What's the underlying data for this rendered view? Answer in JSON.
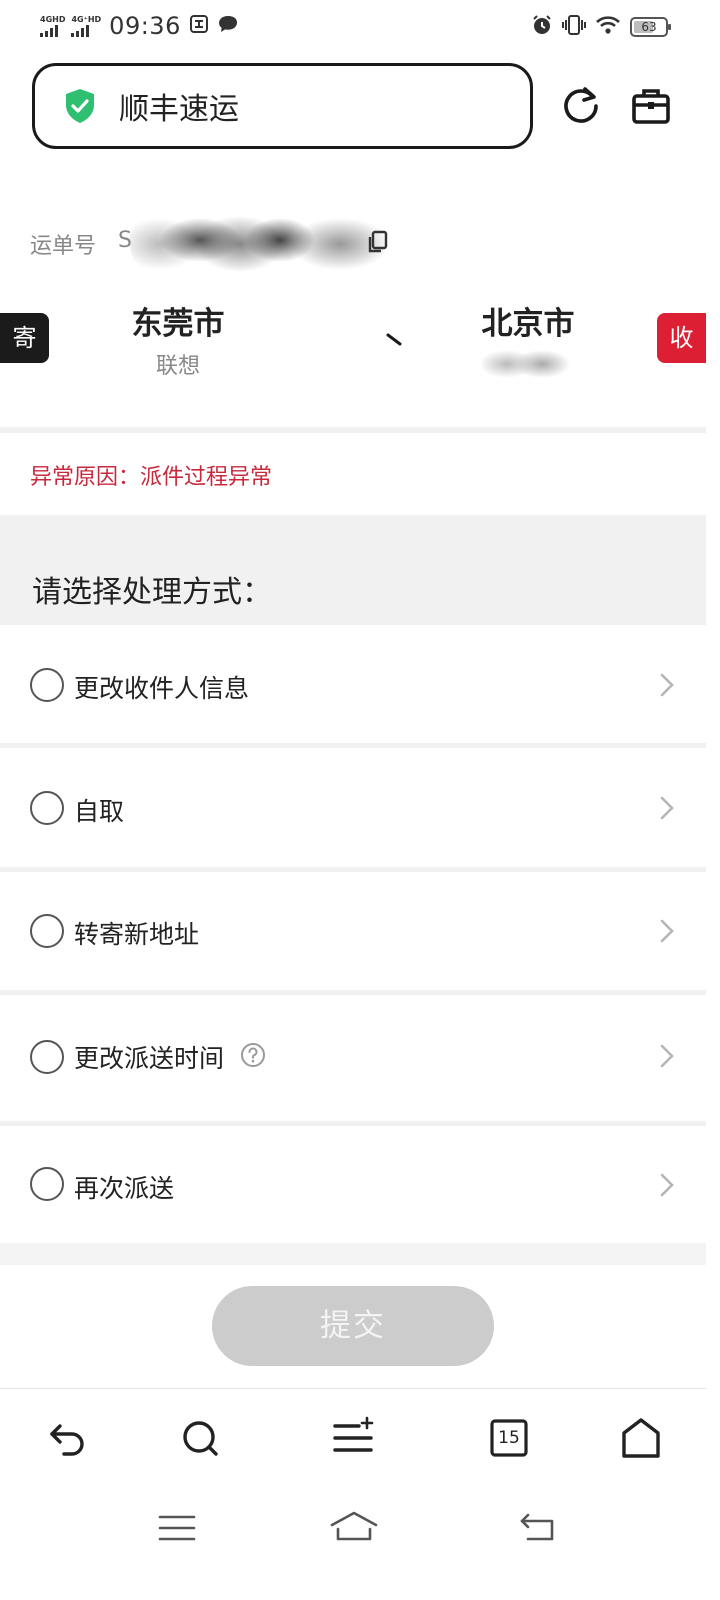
{
  "status_bar": {
    "net1": "4GHD",
    "net2": "4G⁺HD",
    "time": "09:36",
    "battery": "63",
    "battery_level_pct": 63
  },
  "header": {
    "search_text": "顺丰速运"
  },
  "waybill": {
    "label": "运单号",
    "number_prefix": "S"
  },
  "route": {
    "send_tag": "寄",
    "receive_tag": "收",
    "from_city": "东莞市",
    "from_sub": "联想",
    "to_city": "北京市"
  },
  "exception": {
    "text": "异常原因：派件过程异常"
  },
  "handling": {
    "title": "请选择处理方式：",
    "options": [
      {
        "label": "更改收件人信息"
      },
      {
        "label": "自取"
      },
      {
        "label": "转寄新地址"
      },
      {
        "label": "更改派送时间"
      },
      {
        "label": "再次派送"
      }
    ]
  },
  "submit_label": "提交",
  "bottom_nav": {
    "tabs_count": "15"
  },
  "colors": {
    "accent_red": "#dc1f32",
    "shield_green": "#2fbf71",
    "exception_red": "#c8283c"
  }
}
